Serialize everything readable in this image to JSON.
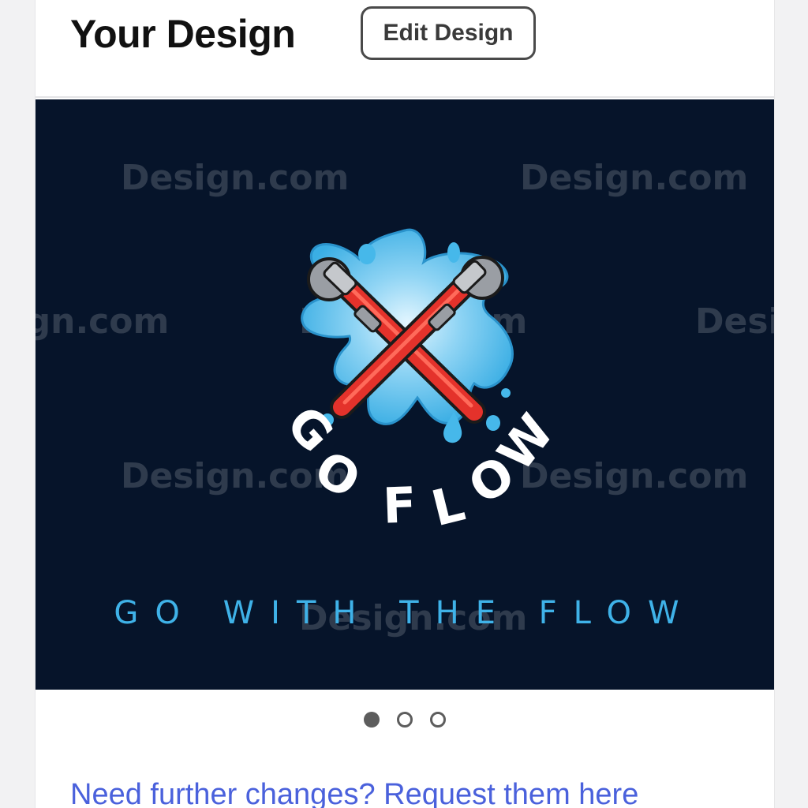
{
  "header": {
    "title": "Your Design",
    "edit_button_label": "Edit Design"
  },
  "preview": {
    "watermark_text": "Design.com",
    "logo_name": "GO FLOW",
    "tagline": "GO WITH THE FLOW",
    "logo_icon": "crossed-pipe-wrenches-water-splash",
    "colors": {
      "background": "#06142a",
      "wrench_red": "#e4322b",
      "wrench_gray": "#9a9ea4",
      "water_blue": "#45b7ea",
      "tagline": "#3fb2e8"
    }
  },
  "carousel": {
    "page_count": 3,
    "active_index": 0
  },
  "footer": {
    "request_link_text": "Need further changes? Request them here"
  }
}
